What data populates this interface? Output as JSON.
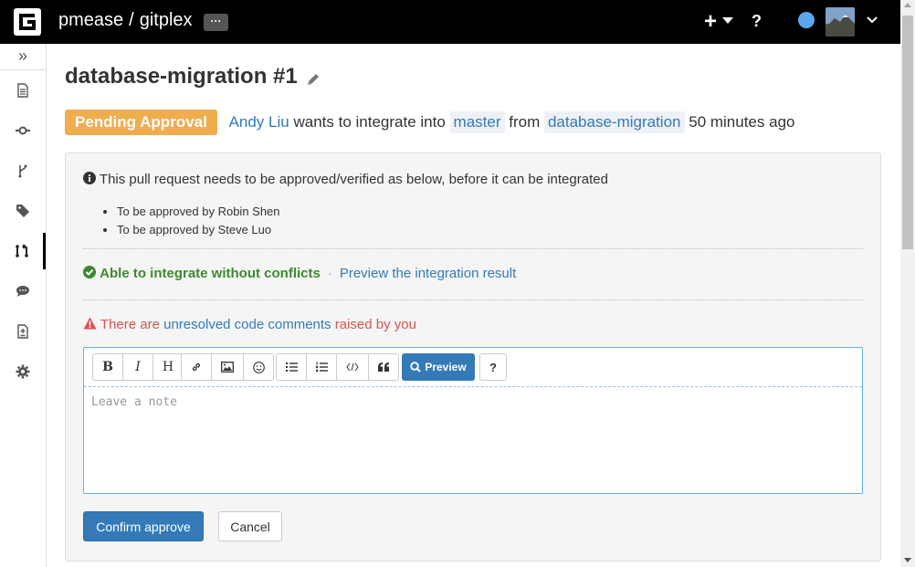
{
  "header": {
    "owner": "pmease",
    "separator": "/",
    "repo": "gitplex",
    "more_label": "···",
    "plus_label": "+",
    "help_label": "?"
  },
  "sidebar": {
    "toggle": "»",
    "items": [
      {
        "name": "files",
        "icon": "file-icon"
      },
      {
        "name": "commits",
        "icon": "commit-icon"
      },
      {
        "name": "branches",
        "icon": "branch-icon"
      },
      {
        "name": "tags",
        "icon": "tag-icon"
      },
      {
        "name": "pull-requests",
        "icon": "pull-request-icon",
        "active": true
      },
      {
        "name": "comments",
        "icon": "comment-icon"
      },
      {
        "name": "compare",
        "icon": "compare-icon"
      },
      {
        "name": "settings",
        "icon": "gear-icon"
      }
    ]
  },
  "request": {
    "title": "database-migration #1",
    "status": "Pending Approval",
    "author": "Andy Liu",
    "integrate_text": "wants to integrate into",
    "target_branch": "master",
    "from_text": "from",
    "source_branch": "database-migration",
    "time": "50 minutes ago"
  },
  "panel": {
    "info": "This pull request needs to be approved/verified as below, before it can be integrated",
    "requirements": [
      "To be approved by Robin Shen",
      "To be approved by Steve Luo"
    ],
    "integrate_ok": "Able to integrate without conflicts",
    "dot": "·",
    "preview_link": "Preview the integration result",
    "warn_prefix": "There are",
    "warn_link": "unresolved code comments",
    "warn_suffix": "raised by you"
  },
  "editor": {
    "bold": "B",
    "italic": "I",
    "heading": "H",
    "preview_label": "Preview",
    "help_label": "?",
    "placeholder": "Leave a note",
    "value": ""
  },
  "actions": {
    "confirm": "Confirm approve",
    "cancel": "Cancel"
  },
  "colors": {
    "topbar": "#000000",
    "badge": "#f0ad4e",
    "link": "#337ab7",
    "success": "#3c8a2e",
    "danger": "#d9534f",
    "primary": "#337ab7"
  }
}
